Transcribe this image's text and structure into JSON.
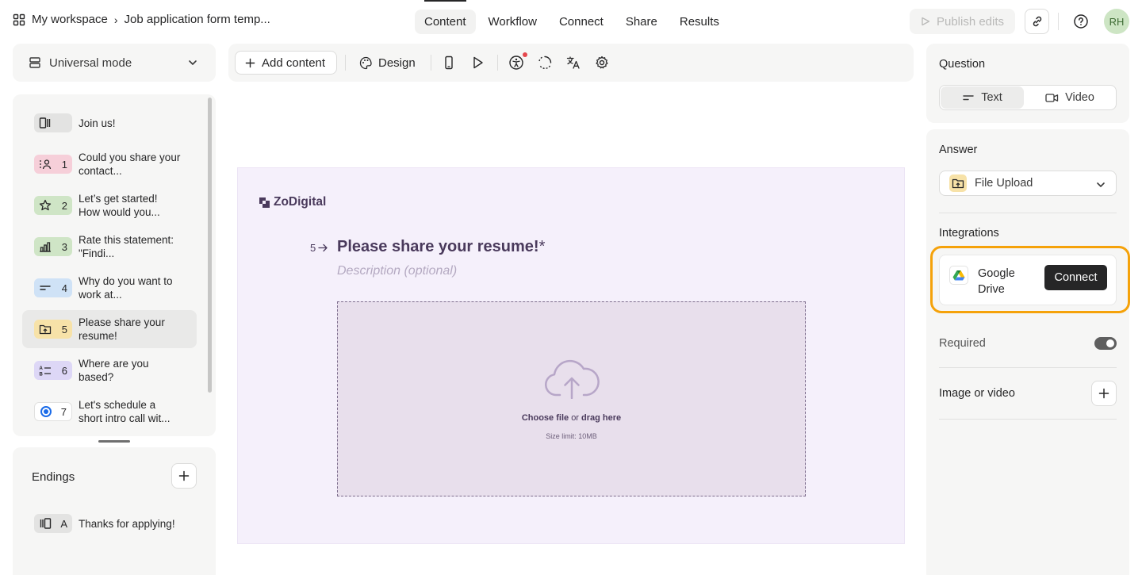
{
  "breadcrumb": {
    "workspace": "My workspace",
    "separator": "›",
    "form": "Job application form temp..."
  },
  "nav": {
    "tabs": [
      "Content",
      "Workflow",
      "Connect",
      "Share",
      "Results"
    ],
    "active": "Content"
  },
  "header": {
    "publish_label": "Publish edits",
    "avatar_initials": "RH"
  },
  "left": {
    "mode_label": "Universal mode",
    "questions": [
      {
        "num": "",
        "text": "Join us!",
        "icon": "welcome-screen-icon",
        "color": "#e3e3e2"
      },
      {
        "num": "1",
        "text": "Could you share your contact...",
        "icon": "contact-info-icon",
        "color": "#f6cfd9"
      },
      {
        "num": "2",
        "text": "Let’s get started! How would you...",
        "icon": "star-rating-icon",
        "color": "#cfe5c6"
      },
      {
        "num": "3",
        "text": "Rate this statement: \"Findi...",
        "icon": "opinion-scale-icon",
        "color": "#cfe5c6"
      },
      {
        "num": "4",
        "text": "Why do you want to work at...",
        "icon": "short-text-icon",
        "color": "#cfe2f6"
      },
      {
        "num": "5",
        "text": "Please share your resume!",
        "icon": "file-upload-icon",
        "color": "#f7e2a8"
      },
      {
        "num": "6",
        "text": "Where are you based?",
        "icon": "dropdown-icon",
        "color": "#ddd7f6"
      },
      {
        "num": "7",
        "text": "Let's schedule a short intro call wit...",
        "icon": "calendly-icon",
        "color": "#ffffff"
      }
    ],
    "endings_title": "Endings",
    "endings": [
      {
        "num": "A",
        "text": "Thanks for applying!",
        "icon": "ending-screen-icon",
        "color": "#e3e3e2"
      }
    ]
  },
  "toolbar": {
    "add_content_label": "Add content",
    "design_label": "Design"
  },
  "canvas": {
    "brand": "ZoDigital",
    "question_number": "5",
    "question_title": "Please share your resume!",
    "required_mark": "*",
    "description_placeholder": "Description (optional)",
    "upload_choose": "Choose file",
    "upload_or": "or",
    "upload_drag": "drag here",
    "size_limit": "Size limit: 10MB",
    "background_color": "#f5f0fb",
    "text_color": "#4a3a5c"
  },
  "right": {
    "question_label": "Question",
    "question_types": [
      "Text",
      "Video"
    ],
    "question_type_active": "Text",
    "answer_label": "Answer",
    "answer_value": "File Upload",
    "integrations_label": "Integrations",
    "integration_name": "Google Drive",
    "connect_label": "Connect",
    "required_label": "Required",
    "required_on": true,
    "image_video_label": "Image or video",
    "highlight_color": "#f5a20a"
  }
}
